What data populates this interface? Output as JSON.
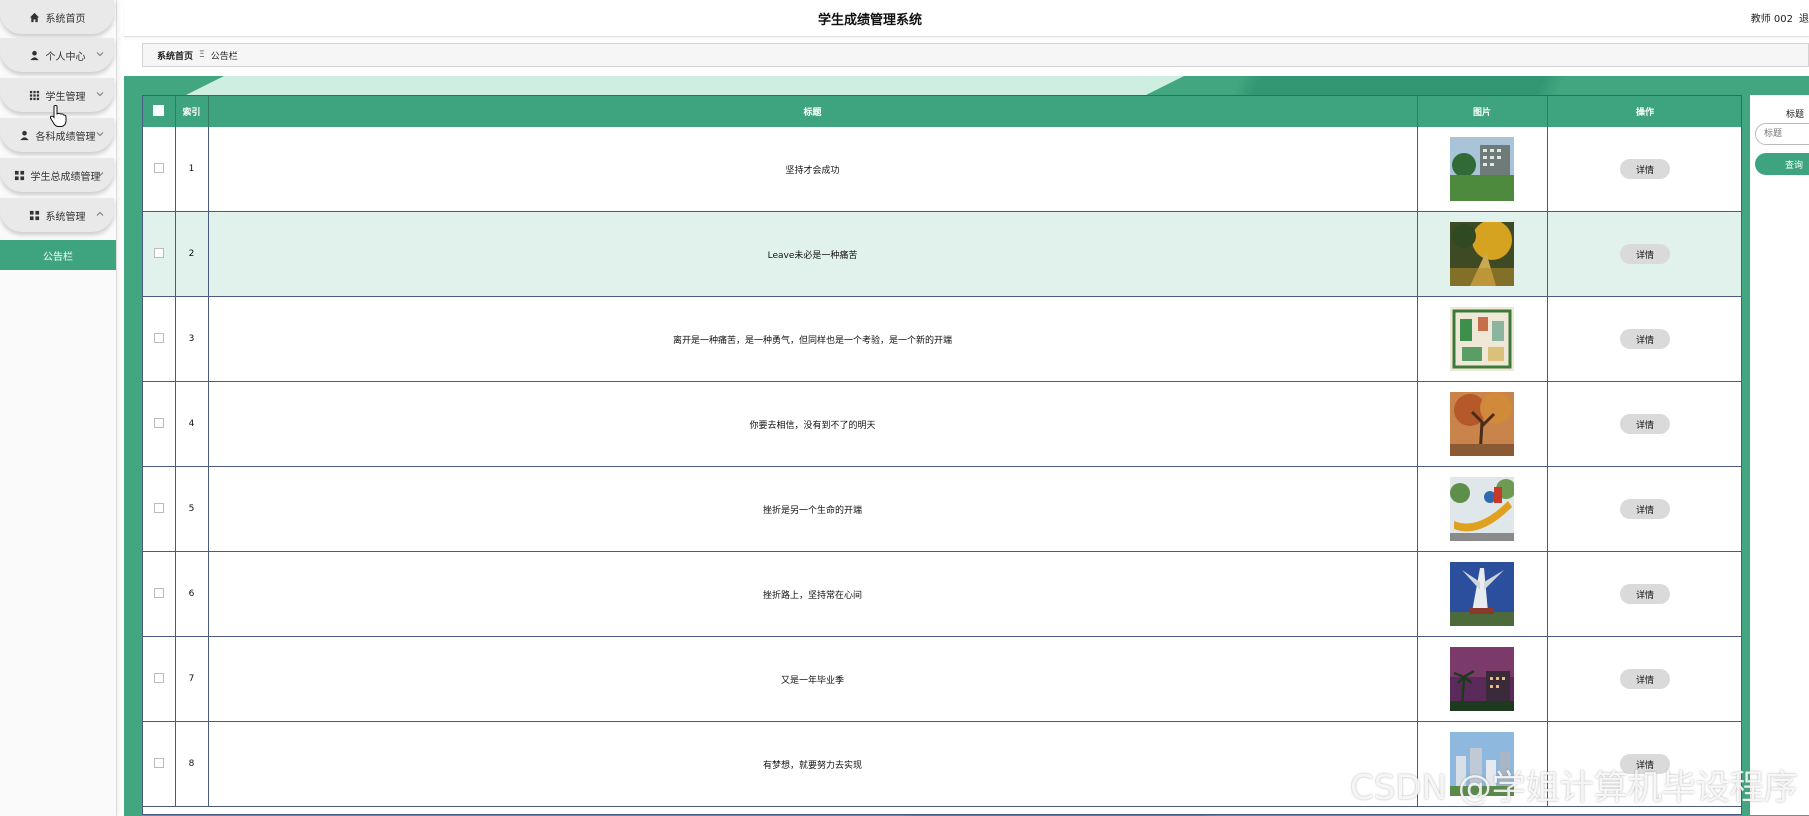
{
  "app_title": "学生成绩管理系统",
  "user": {
    "name": "教师 002",
    "logout": "退"
  },
  "sidebar": {
    "items": [
      {
        "label": "系统首页",
        "icon": "home-icon",
        "has_chevron": false
      },
      {
        "label": "个人中心",
        "icon": "user-icon",
        "has_chevron": true,
        "expanded": false
      },
      {
        "label": "学生管理",
        "icon": "grid-icon",
        "has_chevron": true,
        "expanded": false
      },
      {
        "label": "各科成绩管理",
        "icon": "user-icon",
        "has_chevron": true,
        "expanded": false
      },
      {
        "label": "学生总成绩管理",
        "icon": "apps-icon",
        "has_chevron": true,
        "expanded": false
      },
      {
        "label": "系统管理",
        "icon": "apps-icon",
        "has_chevron": true,
        "expanded": true
      }
    ],
    "active_sub": "公告栏"
  },
  "breadcrumb": {
    "home": "系统首页",
    "separator": "Ξ",
    "current": "公告栏"
  },
  "table": {
    "headers": [
      "",
      "索引",
      "标题",
      "图片",
      "操作"
    ],
    "action_label": "详情",
    "rows": [
      {
        "index": "1",
        "title": "坚持才会成功"
      },
      {
        "index": "2",
        "title": "Leave未必是一种痛苦"
      },
      {
        "index": "3",
        "title": "离开是一种痛苦，是一种勇气，但同样也是一个考验，是一个新的开端"
      },
      {
        "index": "4",
        "title": "你要去相信，没有到不了的明天"
      },
      {
        "index": "5",
        "title": "挫折是另一个生命的开端"
      },
      {
        "index": "6",
        "title": "挫折路上，坚持常在心间"
      },
      {
        "index": "7",
        "title": "又是一年毕业季"
      },
      {
        "index": "8",
        "title": "有梦想，就要努力去实现"
      }
    ]
  },
  "search": {
    "label": "标题",
    "placeholder": "标题",
    "button": "查询"
  },
  "watermark": "CSDN @学姐计算机毕设程序",
  "colors": {
    "accent": "#3ea37f",
    "row_alt": "#e1f2ec",
    "border": "#4a5a80"
  }
}
